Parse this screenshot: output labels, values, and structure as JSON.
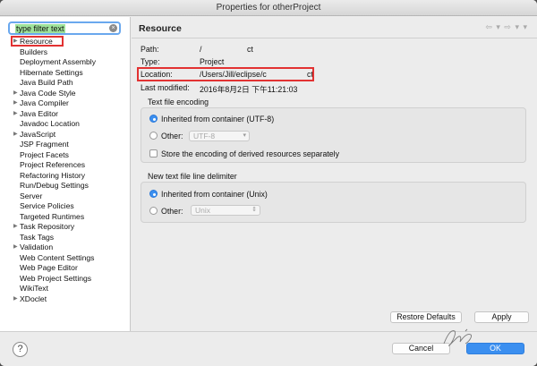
{
  "window": {
    "title": "Properties for otherProject"
  },
  "filter": {
    "placeholder": "type filter text"
  },
  "tree": {
    "items": [
      {
        "label": "Resource",
        "expandable": true
      },
      {
        "label": "Builders",
        "expandable": false
      },
      {
        "label": "Deployment Assembly",
        "expandable": false
      },
      {
        "label": "Hibernate Settings",
        "expandable": false
      },
      {
        "label": "Java Build Path",
        "expandable": false
      },
      {
        "label": "Java Code Style",
        "expandable": true
      },
      {
        "label": "Java Compiler",
        "expandable": true
      },
      {
        "label": "Java Editor",
        "expandable": true
      },
      {
        "label": "Javadoc Location",
        "expandable": false
      },
      {
        "label": "JavaScript",
        "expandable": true
      },
      {
        "label": "JSP Fragment",
        "expandable": false
      },
      {
        "label": "Project Facets",
        "expandable": false
      },
      {
        "label": "Project References",
        "expandable": false
      },
      {
        "label": "Refactoring History",
        "expandable": false
      },
      {
        "label": "Run/Debug Settings",
        "expandable": false
      },
      {
        "label": "Server",
        "expandable": false
      },
      {
        "label": "Service Policies",
        "expandable": false
      },
      {
        "label": "Targeted Runtimes",
        "expandable": false
      },
      {
        "label": "Task Repository",
        "expandable": true
      },
      {
        "label": "Task Tags",
        "expandable": false
      },
      {
        "label": "Validation",
        "expandable": true
      },
      {
        "label": "Web Content Settings",
        "expandable": false
      },
      {
        "label": "Web Page Editor",
        "expandable": false
      },
      {
        "label": "Web Project Settings",
        "expandable": false
      },
      {
        "label": "WikiText",
        "expandable": false
      },
      {
        "label": "XDoclet",
        "expandable": true
      }
    ]
  },
  "resource": {
    "title": "Resource",
    "path_label": "Path:",
    "path_value_start": "/",
    "path_value_end": "ct",
    "type_label": "Type:",
    "type_value": "Project",
    "location_label": "Location:",
    "location_value_start": "/Users/Jill/eclipse/c",
    "location_value_end": "ct",
    "modified_label": "Last modified:",
    "modified_value": "2016年8月2日 下午11:21:03"
  },
  "encoding": {
    "title": "Text file encoding",
    "inherited_label": "Inherited from container (UTF-8)",
    "other_label": "Other:",
    "other_value": "UTF-8",
    "store_label": "Store the encoding of derived resources separately"
  },
  "delimiter": {
    "title": "New text file line delimiter",
    "inherited_label": "Inherited from container (Unix)",
    "other_label": "Other:",
    "other_value": "Unix"
  },
  "buttons": {
    "restore_defaults": "Restore Defaults",
    "apply": "Apply",
    "cancel": "Cancel",
    "ok": "OK",
    "help": "?"
  },
  "colors": {
    "accent": "#3b8ff0",
    "highlight_box": "#e23232",
    "filter_highlight": "#9ee29a"
  }
}
